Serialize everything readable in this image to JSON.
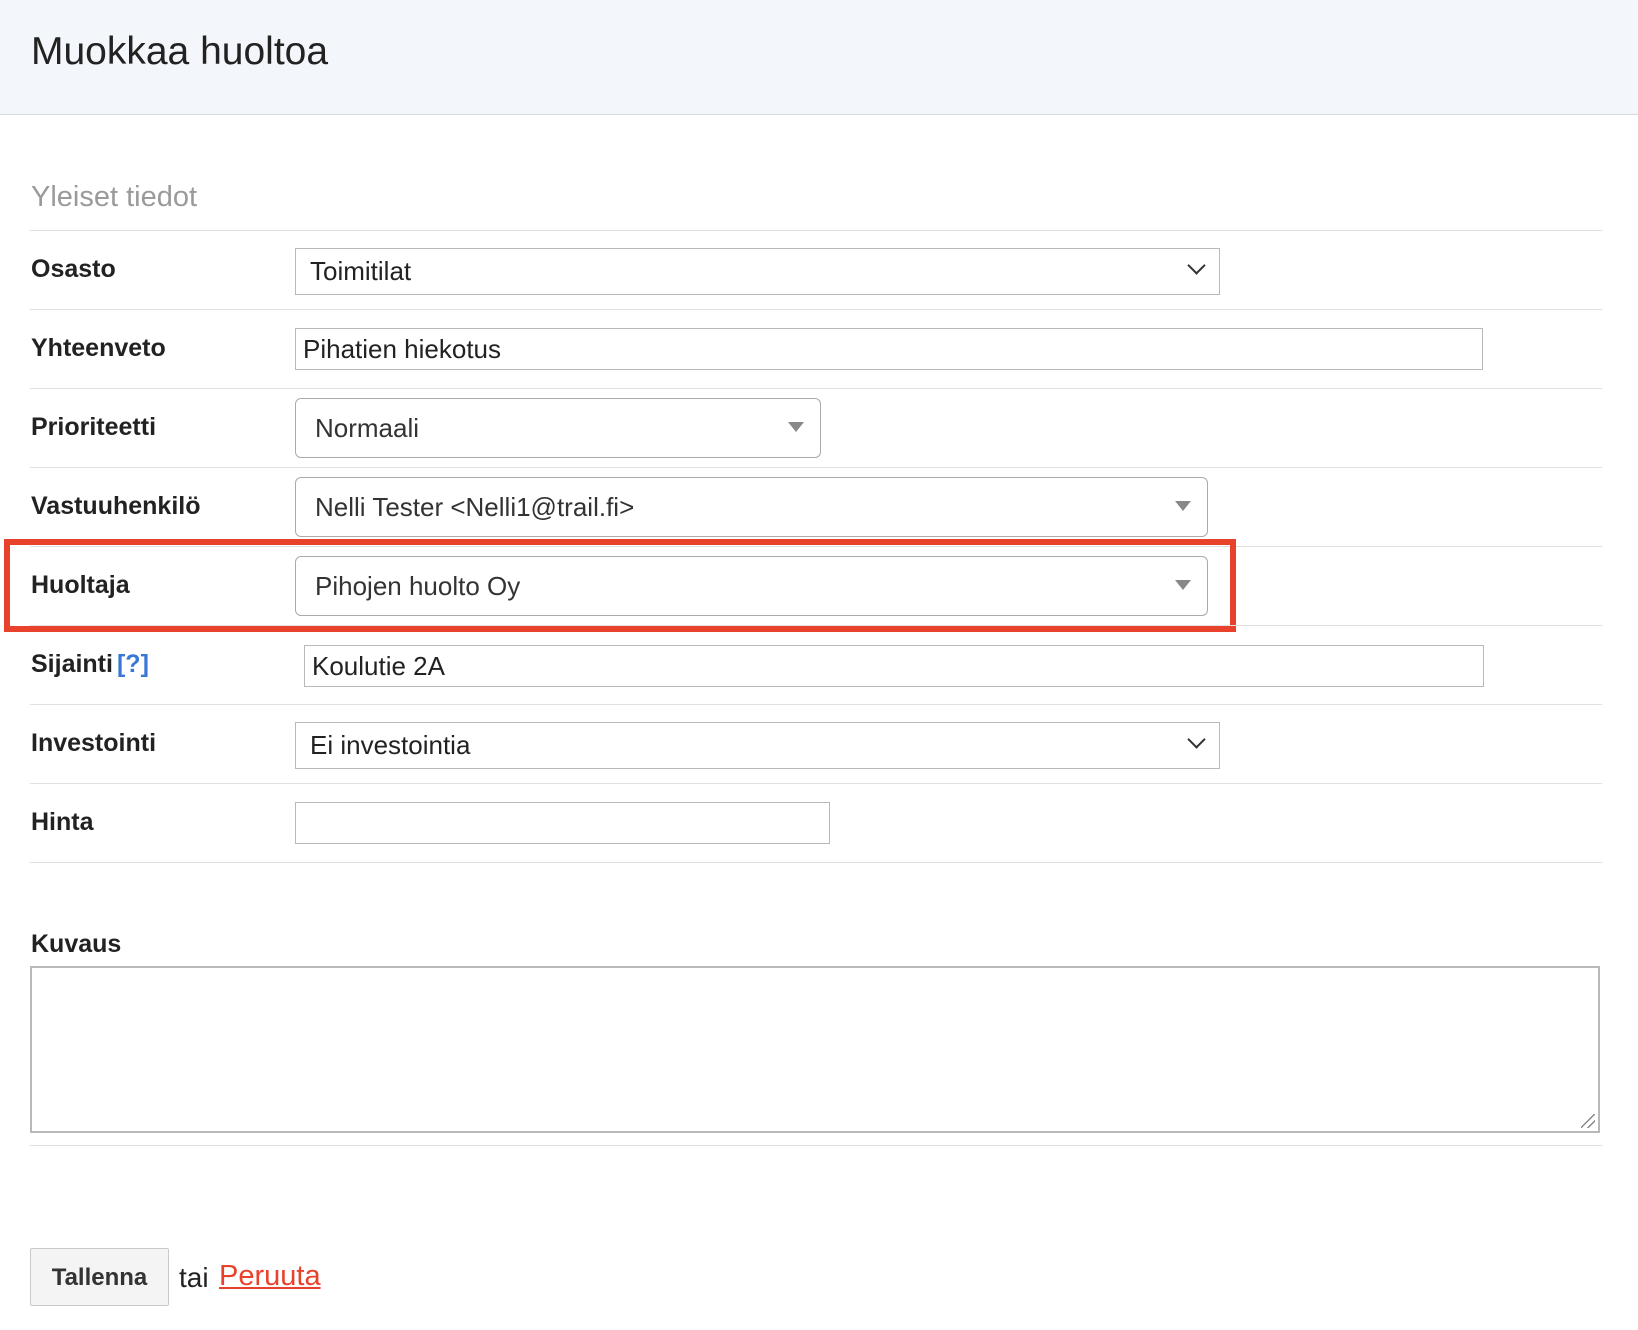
{
  "header": {
    "title": "Muokkaa huoltoa"
  },
  "section": {
    "title": "Yleiset tiedot"
  },
  "fields": {
    "osasto": {
      "label": "Osasto",
      "value": "Toimitilat"
    },
    "yhteenveto": {
      "label": "Yhteenveto",
      "value": "Pihatien hiekotus"
    },
    "prioriteetti": {
      "label": "Prioriteetti",
      "value": "Normaali"
    },
    "vastuuhenkilo": {
      "label": "Vastuuhenkilö",
      "value": "Nelli Tester <Nelli1@trail.fi>"
    },
    "huoltaja": {
      "label": "Huoltaja",
      "value": "Pihojen huolto Oy"
    },
    "sijainti": {
      "label": "Sijainti",
      "help": "[?]",
      "value": "Koulutie 2A"
    },
    "investointi": {
      "label": "Investointi",
      "value": "Ei investointia"
    },
    "hinta": {
      "label": "Hinta",
      "value": ""
    },
    "kuvaus": {
      "label": "Kuvaus",
      "value": ""
    }
  },
  "actions": {
    "save_label": "Tallenna",
    "or_text": "tai",
    "cancel_label": "Peruuta"
  },
  "colors": {
    "highlight": "#e8412c",
    "link": "#3a78d6",
    "header_bg": "#f3f6fa"
  }
}
